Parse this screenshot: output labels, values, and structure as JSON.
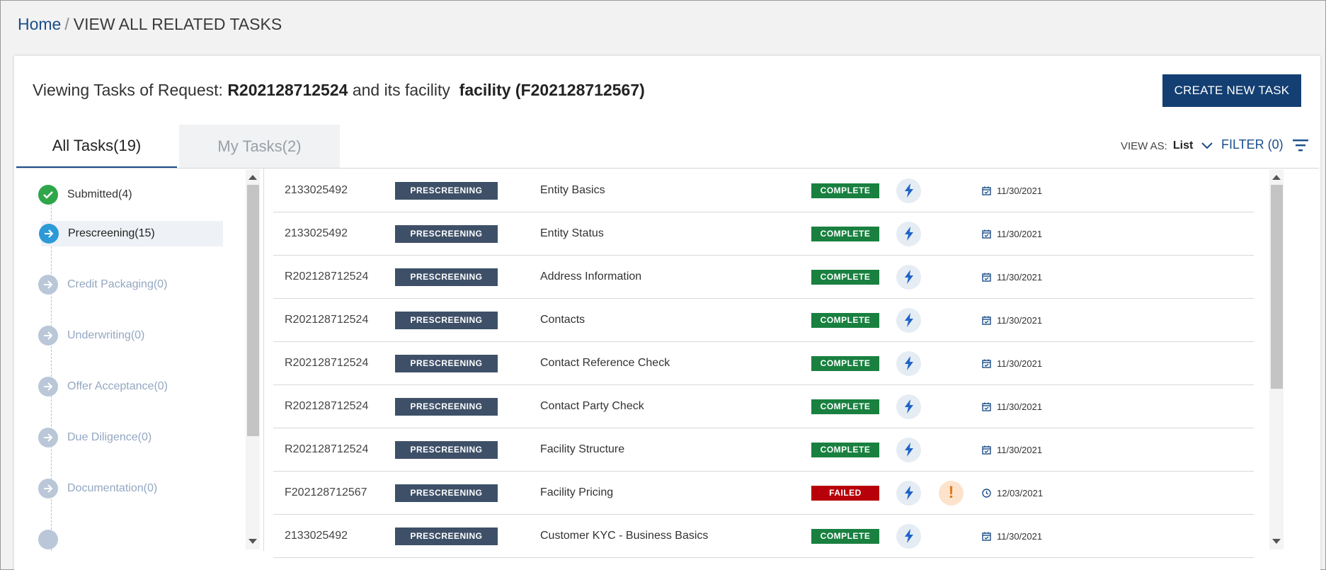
{
  "breadcrumb": {
    "home": "Home",
    "separator": "/",
    "current": "VIEW ALL RELATED TASKS"
  },
  "header": {
    "prefix": "Viewing Tasks of Request:",
    "request_id": "R202128712524",
    "middle": "and its facility",
    "facility": "facility (F202128712567)",
    "create_button": "CREATE NEW TASK"
  },
  "tabs": [
    {
      "label": "All Tasks(19)",
      "active": true
    },
    {
      "label": "My Tasks(2)",
      "active": false
    }
  ],
  "view_as": {
    "label": "VIEW AS:",
    "value": "List"
  },
  "filter": {
    "label": "FILTER (0)"
  },
  "stages": [
    {
      "label": "Submitted(4)",
      "state": "done"
    },
    {
      "label": "Prescreening(15)",
      "state": "current"
    },
    {
      "label": "Credit Packaging(0)",
      "state": "pending"
    },
    {
      "label": "Underwriting(0)",
      "state": "pending"
    },
    {
      "label": "Offer Acceptance(0)",
      "state": "pending"
    },
    {
      "label": "Due Diligence(0)",
      "state": "pending"
    },
    {
      "label": "Documentation(0)",
      "state": "pending"
    }
  ],
  "tasks": [
    {
      "id": "2133025492",
      "stage": "PRESCREENING",
      "name": "Entity Basics",
      "status": "COMPLETE",
      "warning": false,
      "date_icon": "calendar-check-icon",
      "date": "11/30/2021"
    },
    {
      "id": "2133025492",
      "stage": "PRESCREENING",
      "name": "Entity Status",
      "status": "COMPLETE",
      "warning": false,
      "date_icon": "calendar-check-icon",
      "date": "11/30/2021"
    },
    {
      "id": "R202128712524",
      "stage": "PRESCREENING",
      "name": "Address Information",
      "status": "COMPLETE",
      "warning": false,
      "date_icon": "calendar-check-icon",
      "date": "11/30/2021"
    },
    {
      "id": "R202128712524",
      "stage": "PRESCREENING",
      "name": "Contacts",
      "status": "COMPLETE",
      "warning": false,
      "date_icon": "calendar-check-icon",
      "date": "11/30/2021"
    },
    {
      "id": "R202128712524",
      "stage": "PRESCREENING",
      "name": "Contact Reference Check",
      "status": "COMPLETE",
      "warning": false,
      "date_icon": "calendar-check-icon",
      "date": "11/30/2021"
    },
    {
      "id": "R202128712524",
      "stage": "PRESCREENING",
      "name": "Contact Party Check",
      "status": "COMPLETE",
      "warning": false,
      "date_icon": "calendar-check-icon",
      "date": "11/30/2021"
    },
    {
      "id": "R202128712524",
      "stage": "PRESCREENING",
      "name": "Facility Structure",
      "status": "COMPLETE",
      "warning": false,
      "date_icon": "calendar-check-icon",
      "date": "11/30/2021"
    },
    {
      "id": "F202128712567",
      "stage": "PRESCREENING",
      "name": "Facility Pricing",
      "status": "FAILED",
      "warning": true,
      "warning_glyph": "!",
      "date_icon": "clock-icon",
      "date": "12/03/2021"
    },
    {
      "id": "2133025492",
      "stage": "PRESCREENING",
      "name": "Customer KYC - Business Basics",
      "status": "COMPLETE",
      "warning": false,
      "date_icon": "calendar-check-icon",
      "date": "11/30/2021"
    }
  ],
  "colors": {
    "primary": "#133f72",
    "link": "#1b4d89",
    "complete": "#198040",
    "failed": "#b8000a",
    "stage_badge": "#3e5068",
    "stage_done": "#2ea64a",
    "stage_current": "#2d9ad8",
    "stage_pending": "#b9c7d8"
  }
}
